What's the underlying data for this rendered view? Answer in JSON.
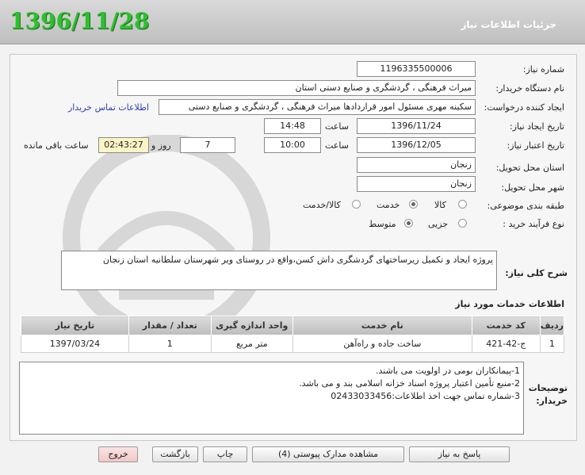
{
  "header": {
    "date": "1396/11/28",
    "title": "جزئیات اطلاعات نیاز"
  },
  "form": {
    "need_number_label": "شماره نیاز:",
    "need_number": "1196335500006",
    "buyer_org_label": "نام دستگاه خریدار:",
    "buyer_org": "میراث فرهنگی ، گردشگری و صنایع دستی استان",
    "requester_label": "ایجاد کننده درخواست:",
    "requester": "سکینه مهری مسئول امور قراردادها  میراث فرهنگی ، گردشگری و صنایع دستی",
    "contact_link": "اطلاعات تماس خریدار",
    "created_date_label": "تاریخ ایجاد نیاز:",
    "created_date": "1396/11/24",
    "time_label": "ساعت",
    "created_time": "14:48",
    "valid_date_label": "تاریخ اعتبار نیاز:",
    "valid_date": "1396/12/05",
    "valid_time": "10:00",
    "days": "7",
    "days_label": "روز و",
    "remaining": "02:43:27",
    "remaining_label": "ساعت باقی مانده",
    "province_label": "استان محل تحویل:",
    "province": "زنجان",
    "city_label": "شهر محل تحویل:",
    "city": "زنجان",
    "category_label": "طبقه بندی موضوعی:",
    "category_options": [
      "کالا",
      "خدمت",
      "کالا/خدمت"
    ],
    "category_selected": "خدمت",
    "process_label": "نوع فرآیند خرید :",
    "process_options": [
      "جزیی",
      "متوسط"
    ],
    "process_selected": "متوسط"
  },
  "description": {
    "label": "شرح کلی نیاز:",
    "text": "پروژه ایجاد و تکمیل زیرساختهای گردشگری داش کسن،واقع در روستای ویر شهرستان سلطانیه استان زنجان"
  },
  "services": {
    "section_title": "اطلاعات خدمات مورد نیاز",
    "columns": [
      "ردیف",
      "کد خدمت",
      "نام خدمت",
      "واحد اندازه گیری",
      "تعداد / مقدار",
      "تاریخ نیاز"
    ],
    "rows": [
      [
        "1",
        "ج-42-421",
        "ساخت جاده و راه‌آهن",
        "متر مربع",
        "1",
        "1397/03/24"
      ]
    ]
  },
  "notes": {
    "label": "توضیحات خریدار:",
    "lines": [
      "1-پیمانکاران بومی در اولویت می باشند.",
      "2-منبع تأمین اعتبار پروژه اسناد خزانه اسلامی بند و می باشد.",
      "3-شماره تماس جهت اخذ اطلاعات:02433033456"
    ]
  },
  "buttons": {
    "reply": "پاسخ به نیاز",
    "attachments": "مشاهده مدارک پیوستی (4)",
    "print": "چاپ",
    "back": "بازگشت",
    "exit": "خروج"
  },
  "colors": {
    "date_green": "#2ec02e",
    "link_blue": "#2b3eb8",
    "remaining_bg": "#fbf4c6",
    "exit_bg": "#f6d3d3"
  }
}
